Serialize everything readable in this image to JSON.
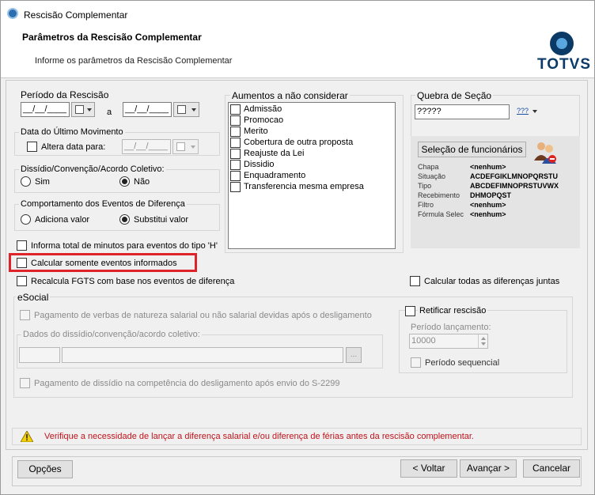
{
  "window": {
    "title": "Rescisão Complementar"
  },
  "header": {
    "title": "Parâmetros da Rescisão Complementar",
    "subtitle": "Informe os parâmetros da Rescisão Complementar",
    "logo": "TOTVS"
  },
  "periodo": {
    "legend": "Período da Rescisão",
    "start": "__/__/____",
    "end": "__/__/____",
    "separator": "a"
  },
  "ultimo_movimento": {
    "legend": "Data do Último Movimento",
    "checkbox_label": "Altera data para:",
    "date": "__/__/____"
  },
  "dissidio": {
    "legend": "Dissídio/Convenção/Acordo Coletivo:",
    "options": [
      "Sim",
      "Não"
    ],
    "selected": "Não"
  },
  "comportamento": {
    "legend": "Comportamento dos Eventos de Diferença",
    "options": [
      "Adiciona valor",
      "Substitui valor"
    ],
    "selected": "Substitui valor"
  },
  "aumentos": {
    "legend": "Aumentos a não considerar",
    "items": [
      "Admissão",
      "Promocao",
      "Merito",
      "Cobertura de outra proposta",
      "Reajuste da Lei",
      "Dissidio",
      "Enquadramento",
      "Transferencia mesma empresa"
    ]
  },
  "quebra": {
    "legend": "Quebra de Seção",
    "value": "?????",
    "icon_text": "???"
  },
  "selecao": {
    "button_label": "Seleção de funcionários",
    "rows": [
      {
        "key": "Chapa",
        "value": "<nenhum>"
      },
      {
        "key": "Situação",
        "value": "ACDEFGIKLMNOPQRSTU"
      },
      {
        "key": "Tipo",
        "value": "ABCDEFIMNOPRSTUVWX"
      },
      {
        "key": "Recebimento",
        "value": "DHMOPQST"
      },
      {
        "key": "Filtro",
        "value": "<nenhum>"
      },
      {
        "key": "Fórmula Selec",
        "value": "<nenhum>"
      }
    ]
  },
  "options": {
    "informa_total": "Informa total de minutos para eventos do tipo 'H'",
    "calcular_somente": "Calcular somente eventos informados",
    "recalcula_fgts": "Recalcula FGTS com base nos eventos de diferença",
    "calcular_todas": "Calcular todas as diferenças juntas"
  },
  "esocial": {
    "legend": "eSocial",
    "pagamento_verbas": "Pagamento de verbas de natureza salarial ou não salarial devidas após o desligamento",
    "dados_legend": "Dados do dissídio/convenção/acordo coletivo:",
    "dados_button": "...",
    "pagamento_dissidio": "Pagamento de dissídio na competência do desligamento após envio do S-2299",
    "retificar": "Retificar rescisão",
    "periodo_lancamento_label": "Período lançamento:",
    "periodo_lancamento_value": "10000",
    "periodo_sequencial": "Período sequencial"
  },
  "warning": "Verifique a necessidade de lançar a diferença salarial e/ou diferença de férias antes da rescisão complementar.",
  "footer": {
    "options": "Opções",
    "back": "< Voltar",
    "next": "Avançar >",
    "cancel": "Cancelar"
  },
  "colors": {
    "highlight": "#e0232a",
    "warning_text": "#c0141c",
    "logo": "#0b3a67"
  }
}
